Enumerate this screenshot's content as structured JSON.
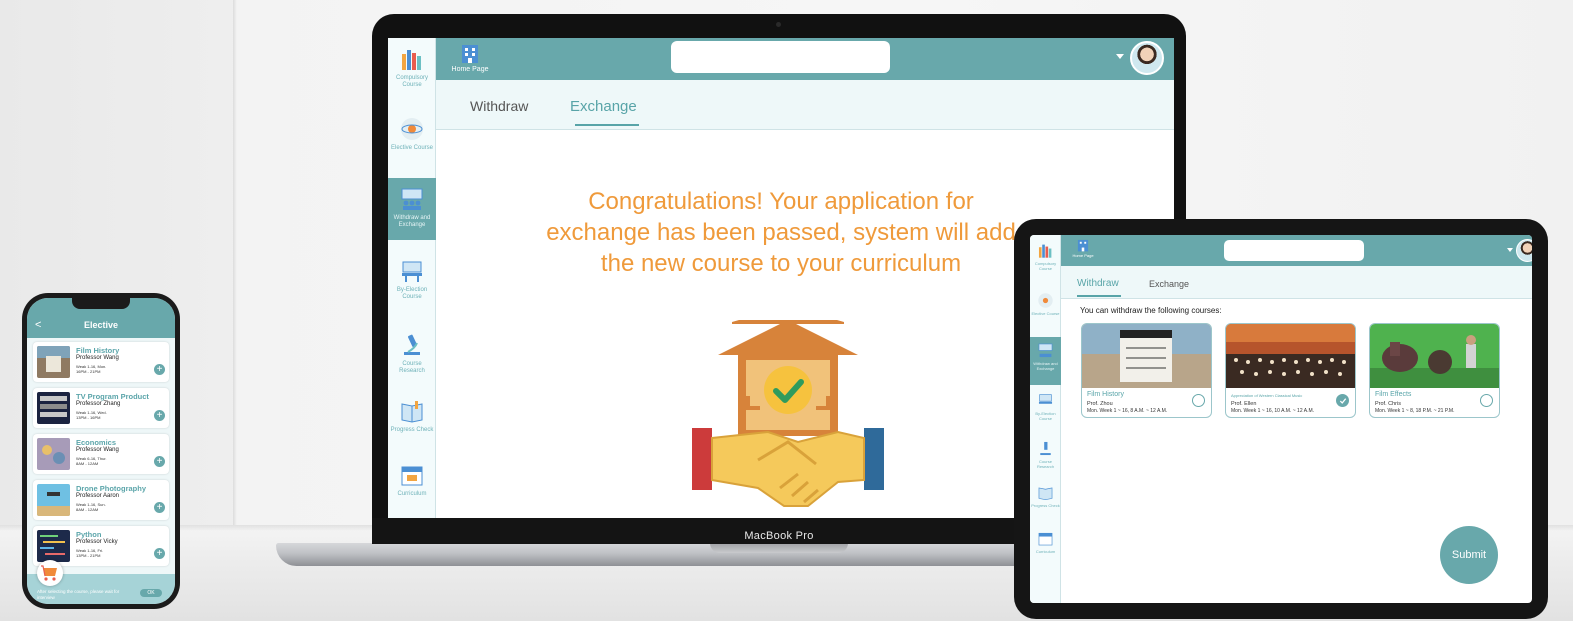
{
  "laptop": {
    "device_label": "MacBook Pro",
    "sidebar": [
      {
        "label": "Compulsory Course",
        "icon": "books-icon"
      },
      {
        "label": "Elective Course",
        "icon": "atom-icon"
      },
      {
        "label": "Withdraw and Exchange",
        "icon": "classroom-icon",
        "active": true
      },
      {
        "label": "By-Election Course",
        "icon": "desk-icon"
      },
      {
        "label": "Course Research",
        "icon": "microscope-icon"
      },
      {
        "label": "Progress Check",
        "icon": "book-icon"
      },
      {
        "label": "Curriculum",
        "icon": "calendar-icon"
      }
    ],
    "header": {
      "home_label": "Home Page",
      "search_placeholder": ""
    },
    "tabs": {
      "withdraw": "Withdraw",
      "exchange": "Exchange"
    },
    "active_tab": "Exchange",
    "message": "Congratulations! Your application for exchange has been passed, system will add the new course to your curriculum"
  },
  "tablet": {
    "header": {
      "home_label": "Home Page",
      "search_placeholder": ""
    },
    "tabs": {
      "withdraw": "Withdraw",
      "exchange": "Exchange"
    },
    "active_tab": "Withdraw",
    "hint": "You can withdraw the following courses:",
    "courses": [
      {
        "title": "Film History",
        "prof": "Prof. Zhou",
        "time": "Mon.   Week 1 ~ 16,  8 A.M. ~ 12 A.M.",
        "checked": false
      },
      {
        "title": "Appreciation of Western Classical Music",
        "prof": "Prof. Ellen",
        "time": "Mon.   Week 1 ~ 16,  10 A.M. ~ 12 A.M.",
        "checked": true
      },
      {
        "title": "Film Effects",
        "prof": "Prof. Chris",
        "time": "Mon.   Week 1 ~ 8,  18 P.M. ~ 21 P.M.",
        "checked": false
      }
    ],
    "submit_label": "Submit"
  },
  "phone": {
    "title": "Elective",
    "back_label": "<",
    "items": [
      {
        "name": "Film History",
        "prof": "Professor Wang",
        "time1": "Weak 1-16, Mon.",
        "time2": "16PM - 21PM"
      },
      {
        "name": "TV Program Product",
        "prof": "Professor Zhang",
        "time1": "Weak 1-16, Wed.",
        "time2": "13PM - 16PM"
      },
      {
        "name": "Economics",
        "prof": "Professor Wang",
        "time1": "Weak 6-16, Thur.",
        "time2": "8AM - 12AM"
      },
      {
        "name": "Drone Photography",
        "prof": "Professor Aaron",
        "time1": "Weak 1-16, Sun.",
        "time2": "8AM - 12AM"
      },
      {
        "name": "Python",
        "prof": "Professor Vicky",
        "time1": "Weak 1-16, Fri.",
        "time2": "13PM - 21PM"
      }
    ],
    "add_label": "+",
    "footer_text": "After selecting the course, please wait for interview",
    "ok_label": "OK"
  },
  "colors": {
    "teal": "#68a8ab",
    "orange": "#ef9a3b"
  }
}
